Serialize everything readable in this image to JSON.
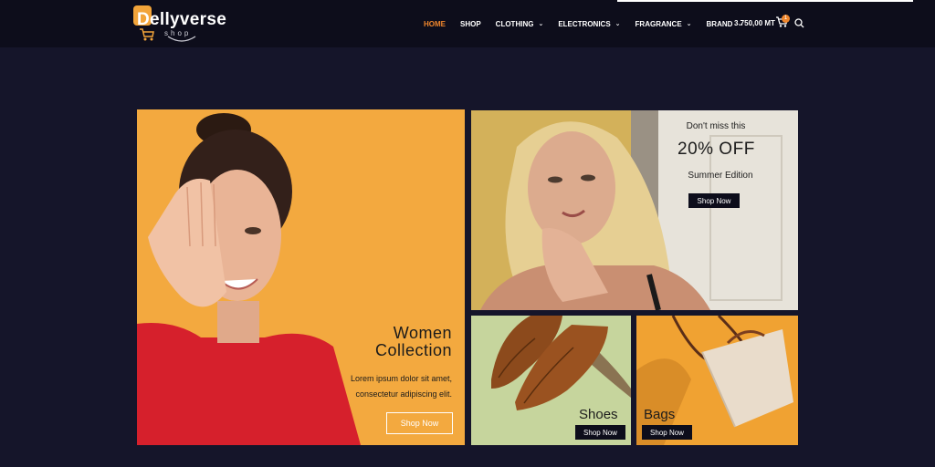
{
  "header": {
    "logo_text": "Dellyverse",
    "logo_sub": "shop",
    "nav": [
      {
        "label": "HOME",
        "active": true,
        "dropdown": false
      },
      {
        "label": "SHOP",
        "active": false,
        "dropdown": false
      },
      {
        "label": "CLOTHING",
        "active": false,
        "dropdown": true
      },
      {
        "label": "ELECTRONICS",
        "active": false,
        "dropdown": true
      },
      {
        "label": "FRAGRANCE",
        "active": false,
        "dropdown": true
      },
      {
        "label": "BRAND",
        "active": false,
        "dropdown": true
      }
    ],
    "cart_total": "3 750,00 MT",
    "cart_count": "1"
  },
  "banners": {
    "women": {
      "title_line1": "Women",
      "title_line2": "Collection",
      "desc": "Lorem ipsum dolor sit amet, consectetur adipiscing elit.",
      "button": "Shop Now"
    },
    "sale": {
      "top": "Don't miss this",
      "off": "20% OFF",
      "edition": "Summer Edition",
      "button": "Shop Now"
    },
    "shoes": {
      "label": "Shoes",
      "button": "Shop Now"
    },
    "bags": {
      "label": "Bags",
      "button": "Shop Now"
    }
  },
  "colors": {
    "accent": "#f0862c",
    "background": "#15152a",
    "header": "#0d0d1b",
    "women_bg": "#f3a93f",
    "bags_bg": "#f2a331"
  }
}
